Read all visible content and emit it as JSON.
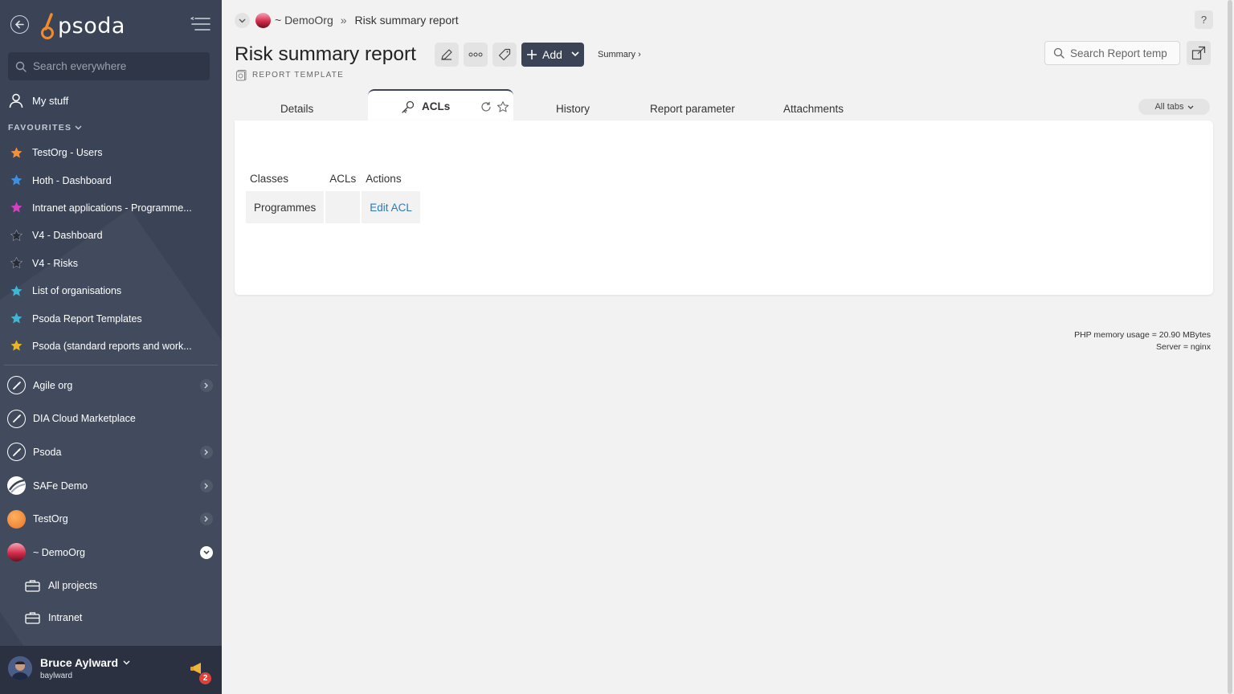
{
  "sidebar": {
    "logo_text": "psoda",
    "search_placeholder": "Search everywhere",
    "my_stuff": "My stuff",
    "favourites_label": "FAVOURITES",
    "favourites": [
      {
        "label": "TestOrg - Users",
        "star_color": "#f2913b"
      },
      {
        "label": "Hoth - Dashboard",
        "star_color": "#3e8fe0"
      },
      {
        "label": "Intranet applications - Programme...",
        "star_color": "#d43fc4"
      },
      {
        "label": "V4 - Dashboard",
        "star_color": "#2a2f3a"
      },
      {
        "label": "V4 - Risks",
        "star_color": "#2a2f3a"
      },
      {
        "label": "List of organisations",
        "star_color": "#3fb6d6"
      },
      {
        "label": "Psoda Report Templates",
        "star_color": "#3fb6d6"
      },
      {
        "label": "Psoda (standard reports and work...",
        "star_color": "#e8b623"
      }
    ],
    "orgs": [
      {
        "label": "Agile org",
        "icon": "rocket-icon",
        "chevron": "right"
      },
      {
        "label": "DIA Cloud Marketplace",
        "icon": "rocket-icon",
        "chevron": "none"
      },
      {
        "label": "Psoda",
        "icon": "rocket-icon",
        "chevron": "right"
      },
      {
        "label": "SAFe Demo",
        "icon": "safe-logo-icon",
        "chevron": "right"
      },
      {
        "label": "TestOrg",
        "icon": "orange-circle-icon",
        "chevron": "right"
      },
      {
        "label": "~ DemoOrg",
        "icon": "sunset-icon",
        "chevron": "open"
      }
    ],
    "sub_items": [
      "All projects",
      "Intranet"
    ],
    "user": {
      "name": "Bruce Aylward",
      "login": "baylward",
      "notifications": "2"
    }
  },
  "breadcrumb": {
    "org": "~ DemoOrg",
    "separator": "»",
    "current": "Risk summary report"
  },
  "header": {
    "title": "Risk summary report",
    "type_label": "REPORT TEMPLATE",
    "add_label": "Add",
    "summary_link": "Summary ›",
    "search_placeholder": "Search Report temp",
    "help": "?"
  },
  "tabs": {
    "items": [
      "Details",
      "ACLs",
      "History",
      "Report parameter",
      "Attachments"
    ],
    "active": "ACLs",
    "all_tabs": "All tabs"
  },
  "acl_table": {
    "headers": [
      "Classes",
      "ACLs",
      "Actions"
    ],
    "rows": [
      {
        "class": "Programmes",
        "acls": "",
        "action": "Edit ACL"
      }
    ]
  },
  "footer": {
    "memory": "PHP memory usage = 20.90 MBytes",
    "server": "Server = nginx"
  },
  "colors": {
    "sidebar_bg": "#3b4457",
    "accent": "#3b4457",
    "link": "#2a7ab8",
    "logo_orange": "#f28a2e"
  }
}
